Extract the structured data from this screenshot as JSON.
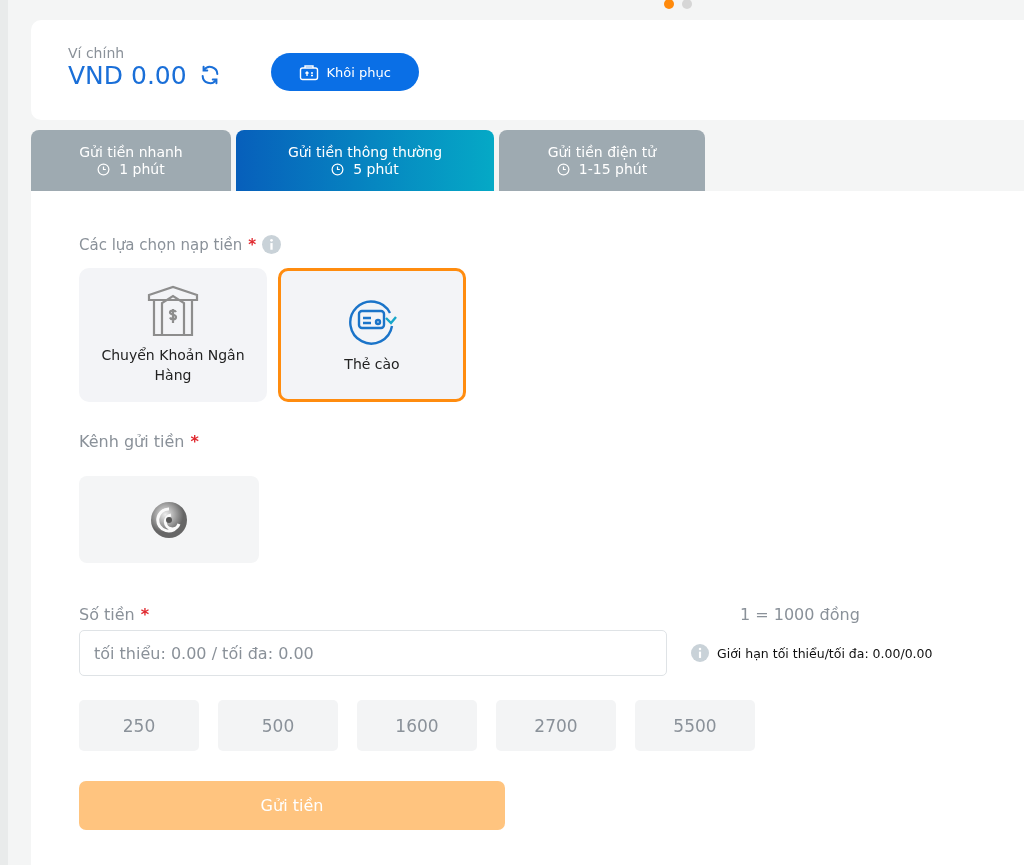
{
  "carousel_dots": [
    {
      "selected": true
    },
    {
      "selected": false
    }
  ],
  "wallet": {
    "label": "Ví chính",
    "balance": "VND 0.00",
    "restore_button": "Khôi phục"
  },
  "tabs": [
    {
      "label": "Gửi tiền nhanh",
      "time": "1 phút",
      "selected": false
    },
    {
      "label": "Gửi tiền thông thường",
      "time": "5 phút",
      "selected": true
    },
    {
      "label": "Gửi tiền điện tử",
      "time": "1-15 phút",
      "selected": false
    }
  ],
  "options": {
    "label": "Các lựa chọn nạp tiền",
    "required_mark": "*",
    "items": [
      {
        "kind": "bank",
        "label": "Chuyển Khoản Ngân Hàng",
        "selected": false
      },
      {
        "kind": "card",
        "label": "Thẻ cào",
        "selected": true
      }
    ]
  },
  "channel": {
    "label": "Kênh gửi tiền",
    "required_mark": "*"
  },
  "amount": {
    "label": "Số tiền",
    "required_mark": "*",
    "rate": "1 = 1000 đồng",
    "placeholder": "tối thiểu: 0.00 / tối đa: 0.00",
    "limit": "Giới hạn tối thiểu/tối đa: 0.00/0.00",
    "presets": [
      "250",
      "500",
      "1600",
      "2700",
      "5500"
    ]
  },
  "submit": {
    "label": "Gửi tiền",
    "disabled": true
  }
}
